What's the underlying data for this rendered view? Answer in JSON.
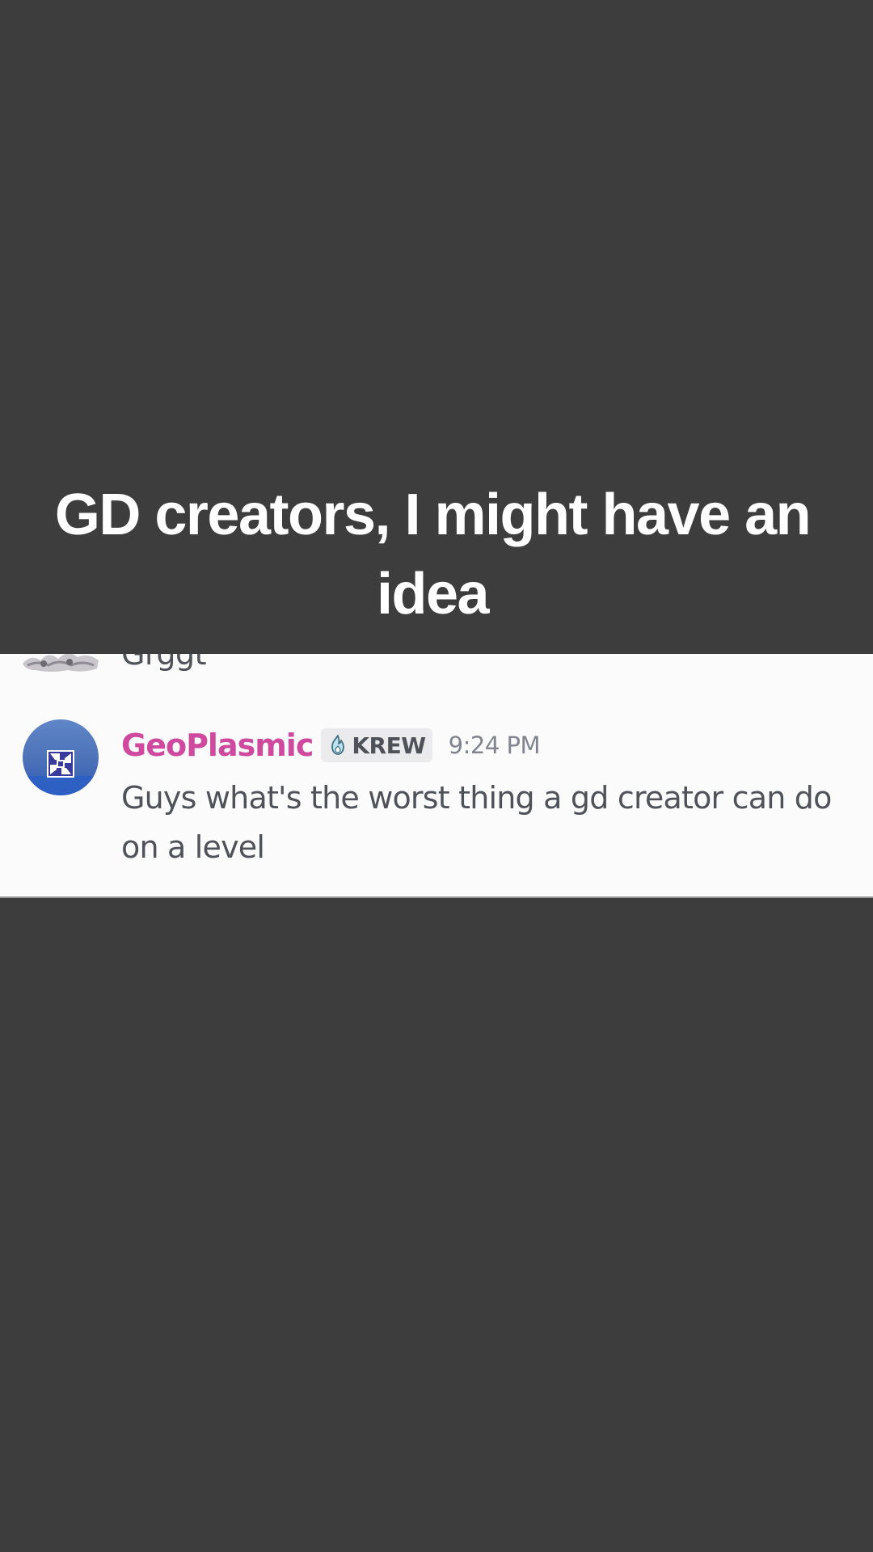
{
  "overlay": {
    "caption": "GD creators, I might have an idea"
  },
  "chat": {
    "previous_message": {
      "text": "Grggt"
    },
    "message": {
      "username": "GeoPlasmic",
      "username_color": "#cf4a9e",
      "tag": {
        "icon": "flame-icon",
        "label": "KREW"
      },
      "timestamp": "9:24 PM",
      "text": "Guys what's the worst thing a gd creator can do on a level"
    }
  },
  "colors": {
    "page_background": "#3d3d3d",
    "card_background": "#fbfbfc",
    "message_text": "#4f5359",
    "timestamp_text": "#80848e"
  }
}
